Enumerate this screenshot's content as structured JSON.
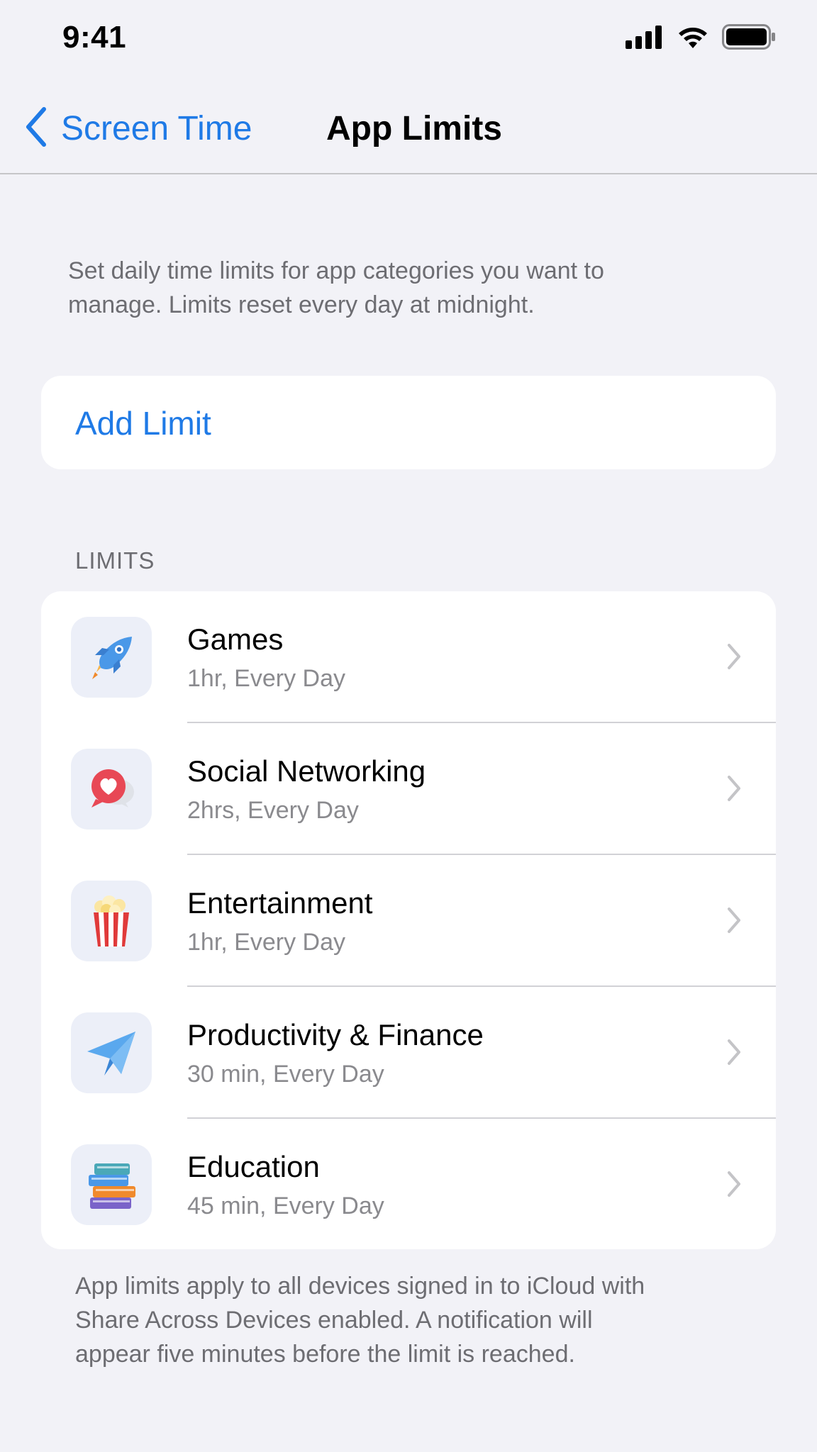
{
  "status_bar": {
    "time": "9:41"
  },
  "nav": {
    "back_label": "Screen Time",
    "title": "App Limits"
  },
  "intro": "Set daily time limits for app categories you want to manage. Limits reset every day at midnight.",
  "add_limit_label": "Add Limit",
  "section_header": "LIMITS",
  "limits": [
    {
      "title": "Games",
      "subtitle": "1hr, Every Day",
      "icon": "rocket-icon"
    },
    {
      "title": "Social Networking",
      "subtitle": "2hrs, Every Day",
      "icon": "heart-chat-icon"
    },
    {
      "title": "Entertainment",
      "subtitle": "1hr, Every Day",
      "icon": "popcorn-icon"
    },
    {
      "title": "Productivity & Finance",
      "subtitle": "30 min, Every Day",
      "icon": "paper-plane-icon"
    },
    {
      "title": "Education",
      "subtitle": "45 min, Every Day",
      "icon": "books-icon"
    }
  ],
  "footer": "App limits apply to all devices signed in to iCloud with Share Across Devices enabled. A notification will appear five minutes before the limit is reached.",
  "colors": {
    "accent": "#1f7ae6",
    "background": "#f2f2f7",
    "secondary_text": "#6d6d72"
  }
}
